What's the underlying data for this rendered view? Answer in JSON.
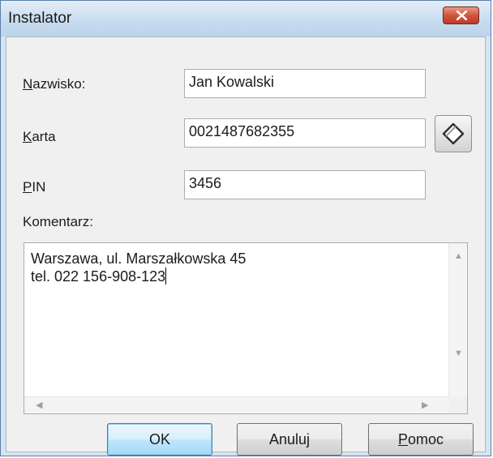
{
  "window": {
    "title": "Instalator"
  },
  "form": {
    "surname": {
      "label_key": "N",
      "label_rest": "azwisko:",
      "value": "Jan Kowalski"
    },
    "card": {
      "label_key": "K",
      "label_rest": "arta",
      "value": "0021487682355"
    },
    "pin": {
      "label_key": "P",
      "label_rest": "IN",
      "value": "3456"
    },
    "comment": {
      "label": "Komentarz:",
      "lines": [
        "Warszawa, ul. Marszałkowska 45",
        "tel. 022 156-908-123"
      ]
    }
  },
  "buttons": {
    "ok": "OK",
    "cancel": "Anuluj",
    "help_key": "P",
    "help_rest": "omoc"
  },
  "icons": {
    "close": "close-icon",
    "card_reader": "card-reader-icon",
    "scroll_up": "scroll-up-arrow-icon",
    "scroll_down": "scroll-down-arrow-icon",
    "scroll_left": "scroll-left-arrow-icon",
    "scroll_right": "scroll-right-arrow-icon"
  },
  "colors": {
    "title_bar": "#c9dcef",
    "close_button": "#c0392b",
    "default_button": "#bee6fd"
  }
}
